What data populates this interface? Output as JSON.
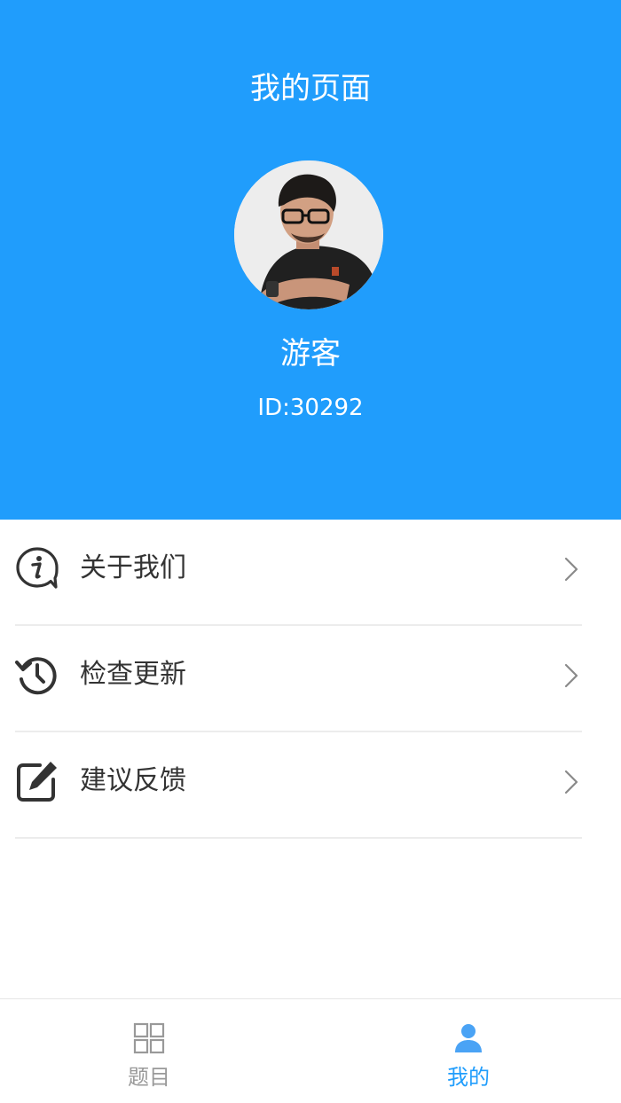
{
  "header": {
    "title": "我的页面",
    "username": "游客",
    "user_id": "ID:30292"
  },
  "menu": {
    "items": [
      {
        "label": "关于我们",
        "icon": "info-bubble-icon"
      },
      {
        "label": "检查更新",
        "icon": "history-clock-icon"
      },
      {
        "label": "建议反馈",
        "icon": "edit-square-icon"
      }
    ]
  },
  "tabbar": {
    "tabs": [
      {
        "label": "题目",
        "icon": "grid-icon",
        "active": false
      },
      {
        "label": "我的",
        "icon": "user-icon",
        "active": true
      }
    ]
  },
  "colors": {
    "primary": "#209dfc",
    "text": "#333333",
    "inactive": "#999999",
    "divider": "#ececec"
  }
}
